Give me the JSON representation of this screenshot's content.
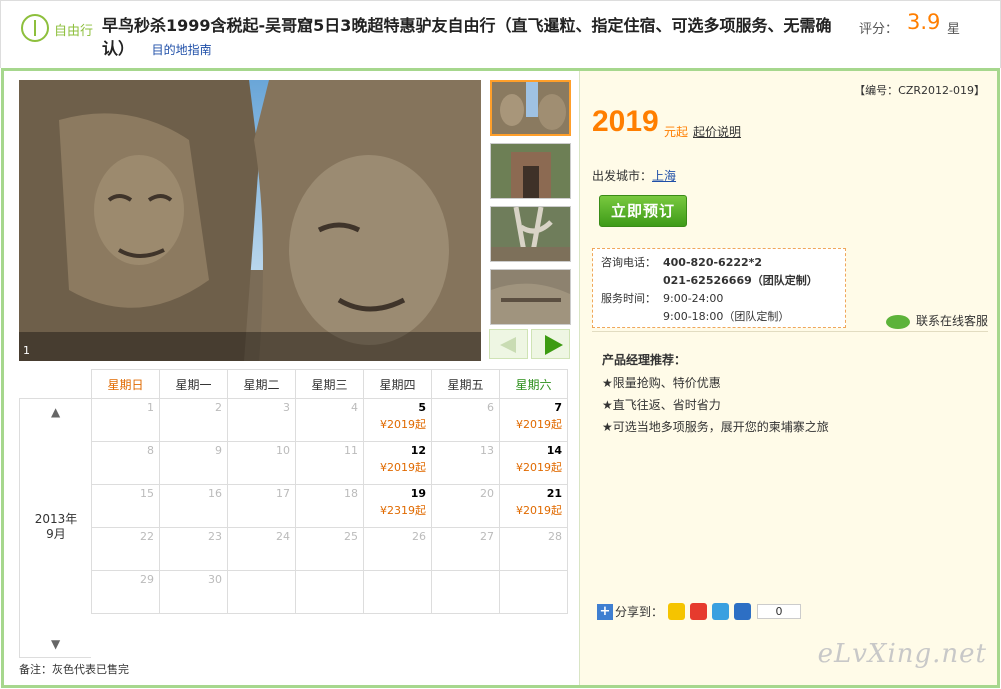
{
  "header": {
    "logo_text": "自由行",
    "title": "早鸟秒杀1999含税起-吴哥窟5日3晚超特惠驴友自由行（直飞暹粒、指定住宿、可选多项服务、无需确认）",
    "guide_link": "目的地指南",
    "rating_label": "评分：",
    "rating_value": "3.9",
    "rating_unit": "星"
  },
  "gallery": {
    "photo_index": "1",
    "thumbnail_count": 4
  },
  "calendar": {
    "year_month": "2013年",
    "month": "9月",
    "up_arrow": "▲",
    "down_arrow": "▼",
    "weekdays": [
      "星期日",
      "星期一",
      "星期二",
      "星期三",
      "星期四",
      "星期五",
      "星期六"
    ],
    "weeks": [
      [
        {
          "d": "1"
        },
        {
          "d": "2"
        },
        {
          "d": "3"
        },
        {
          "d": "4"
        },
        {
          "d": "5",
          "p": "¥2019起"
        },
        {
          "d": "6"
        },
        {
          "d": "7",
          "p": "¥2019起"
        }
      ],
      [
        {
          "d": "8"
        },
        {
          "d": "9"
        },
        {
          "d": "10"
        },
        {
          "d": "11"
        },
        {
          "d": "12",
          "p": "¥2019起"
        },
        {
          "d": "13"
        },
        {
          "d": "14",
          "p": "¥2019起"
        }
      ],
      [
        {
          "d": "15"
        },
        {
          "d": "16"
        },
        {
          "d": "17"
        },
        {
          "d": "18"
        },
        {
          "d": "19",
          "p": "¥2319起"
        },
        {
          "d": "20"
        },
        {
          "d": "21",
          "p": "¥2019起"
        }
      ],
      [
        {
          "d": "22"
        },
        {
          "d": "23"
        },
        {
          "d": "24"
        },
        {
          "d": "25"
        },
        {
          "d": "26"
        },
        {
          "d": "27"
        },
        {
          "d": "28"
        }
      ],
      [
        {
          "d": "29"
        },
        {
          "d": "30"
        },
        {
          "d": ""
        },
        {
          "d": ""
        },
        {
          "d": ""
        },
        {
          "d": ""
        },
        {
          "d": ""
        }
      ]
    ],
    "note": "备注：灰色代表已售完"
  },
  "product": {
    "code": "【编号：CZR2012-019】",
    "price": "2019",
    "price_unit": "元起",
    "price_note": "起价说明",
    "depart_label": "出发城市：",
    "depart_city": "上海",
    "book_label": "立即预订"
  },
  "contact": {
    "phone_label": "咨询电话：",
    "phone1": "400-820-6222*2",
    "phone2": "021-62526669",
    "phone2_note": "（团队定制）",
    "hours_label": "服务时间：",
    "hours1": "9:00-24:00",
    "hours2": "9:00-18:00（团队定制）",
    "chat_label": "联系在线客服"
  },
  "recommend": {
    "title": "产品经理推荐：",
    "items": [
      "★限量抢购、特价优惠",
      "★直飞往返、省时省力",
      "★可选当地多项服务，展开您的柬埔寨之旅"
    ]
  },
  "share": {
    "label": "分享到：",
    "count": "0"
  },
  "watermark": "eLvXing.net",
  "colors": {
    "accent_orange": "#ff7e00",
    "accent_green": "#3e9b18",
    "frame_green": "#a6d78d"
  }
}
